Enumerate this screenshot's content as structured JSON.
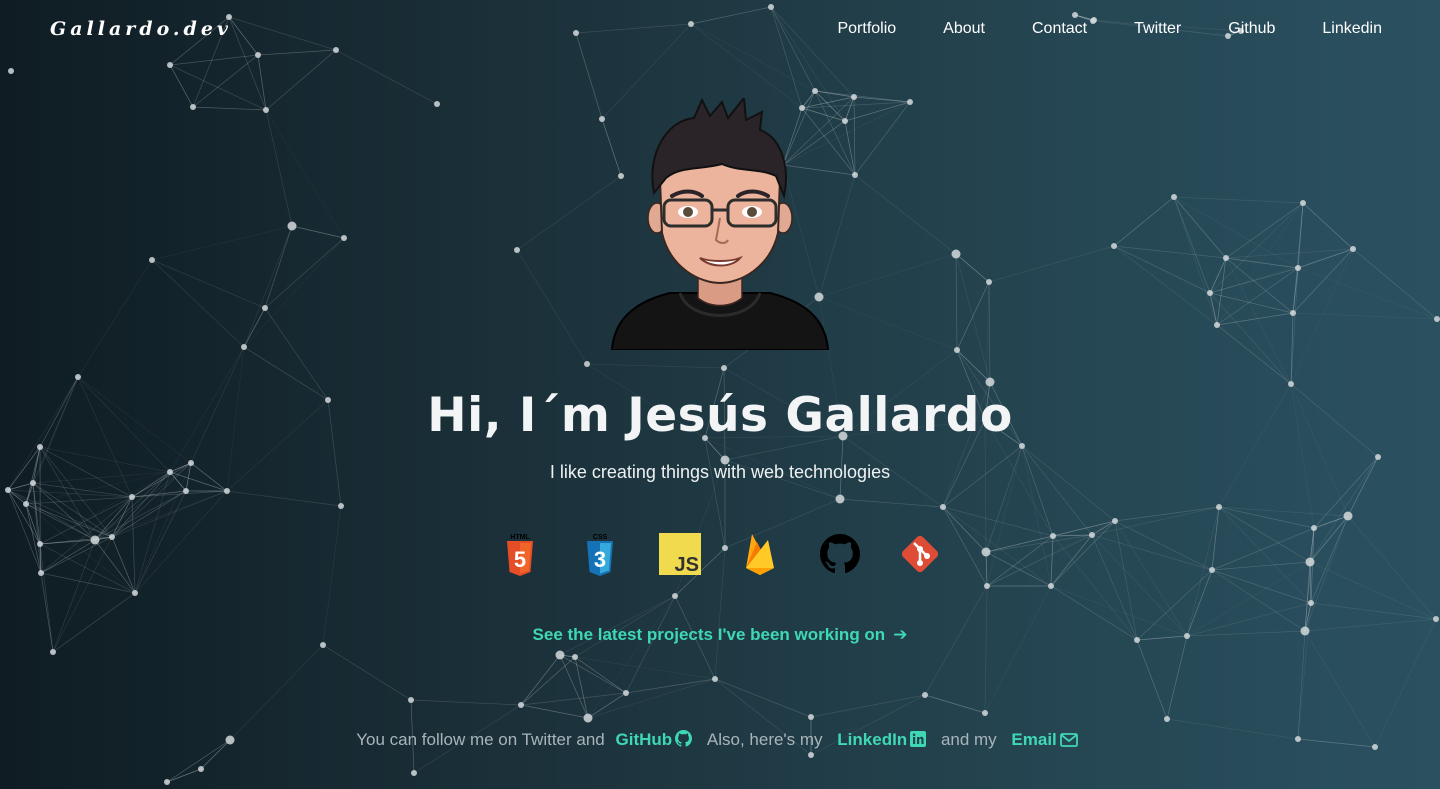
{
  "brand": {
    "logo_text": "Gallardo.dev"
  },
  "nav": {
    "items": [
      {
        "label": "Portfolio"
      },
      {
        "label": "About"
      },
      {
        "label": "Contact"
      },
      {
        "label": "Twitter"
      },
      {
        "label": "Github"
      },
      {
        "label": "Linkedin"
      }
    ]
  },
  "hero": {
    "title": "Hi, I´m Jesús Gallardo",
    "subtitle": "I like creating things with web technologies",
    "tech_icons": [
      {
        "name": "html5-icon",
        "label": "HTML",
        "badge": "5",
        "color": "#e44d26"
      },
      {
        "name": "css3-icon",
        "label": "CSS",
        "badge": "3",
        "color": "#1572b6"
      },
      {
        "name": "javascript-icon",
        "label": "JS",
        "color": "#f0db4f"
      },
      {
        "name": "firebase-icon",
        "color": "#ffa611"
      },
      {
        "name": "github-icon",
        "color": "#000000"
      },
      {
        "name": "git-icon",
        "color": "#de4c36"
      }
    ],
    "cta_label": "See the latest projects I've been working on"
  },
  "follow": {
    "text_1": "You can follow me on Twitter and",
    "github_label": "GitHub",
    "text_2": "Also, here's my",
    "linkedin_label": "LinkedIn",
    "text_3": "and my",
    "email_label": "Email"
  },
  "colors": {
    "accent": "#3fd8b5",
    "background_start": "#0f1c23",
    "background_end": "#2b5161"
  }
}
